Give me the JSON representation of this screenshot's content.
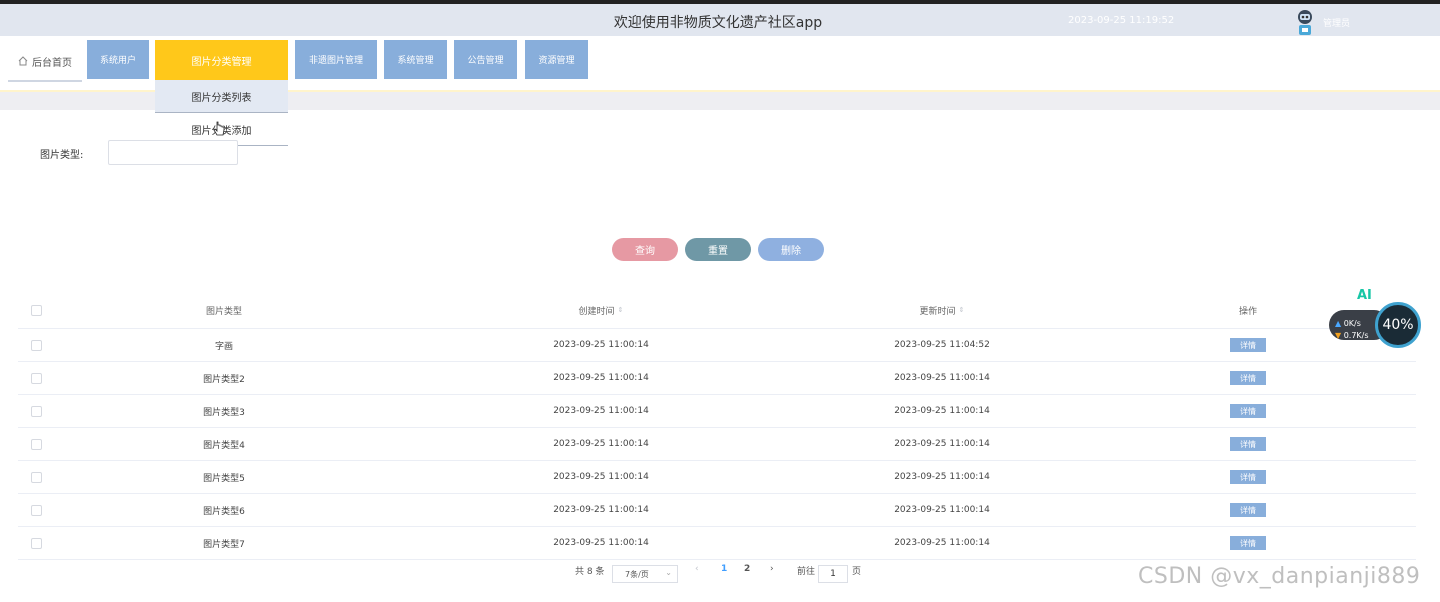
{
  "header": {
    "title": "欢迎使用非物质文化遗产社区app",
    "datetime": "2023-09-25 11:19:52",
    "user": "管理员"
  },
  "nav": {
    "home": "后台首页",
    "items": [
      "系统用户",
      "图片分类管理",
      "非遗图片管理",
      "系统管理",
      "公告管理",
      "资源管理"
    ],
    "active_index": 1,
    "dropdown": [
      "图片分类列表",
      "图片分类添加"
    ]
  },
  "filter": {
    "label": "图片类型:",
    "value": ""
  },
  "buttons": {
    "search": "查询",
    "reset": "重置",
    "delete": "删除"
  },
  "table": {
    "headers": {
      "type": "图片类型",
      "created": "创建时间",
      "updated": "更新时间",
      "op": "操作"
    },
    "sort_icon": "⇕",
    "rows": [
      {
        "type": "字画",
        "created": "2023-09-25 11:00:14",
        "updated": "2023-09-25 11:04:52",
        "op": "详情"
      },
      {
        "type": "图片类型2",
        "created": "2023-09-25 11:00:14",
        "updated": "2023-09-25 11:00:14",
        "op": "详情"
      },
      {
        "type": "图片类型3",
        "created": "2023-09-25 11:00:14",
        "updated": "2023-09-25 11:00:14",
        "op": "详情"
      },
      {
        "type": "图片类型4",
        "created": "2023-09-25 11:00:14",
        "updated": "2023-09-25 11:00:14",
        "op": "详情"
      },
      {
        "type": "图片类型5",
        "created": "2023-09-25 11:00:14",
        "updated": "2023-09-25 11:00:14",
        "op": "详情"
      },
      {
        "type": "图片类型6",
        "created": "2023-09-25 11:00:14",
        "updated": "2023-09-25 11:00:14",
        "op": "详情"
      },
      {
        "type": "图片类型7",
        "created": "2023-09-25 11:00:14",
        "updated": "2023-09-25 11:00:14",
        "op": "详情"
      }
    ]
  },
  "pagination": {
    "total": "共 8 条",
    "page_size": "7条/页",
    "prev": "‹",
    "pages": [
      "1",
      "2"
    ],
    "next": "›",
    "goto_label": "前往",
    "goto_value": "1",
    "goto_suffix": "页"
  },
  "net_widget": {
    "percent": "40%",
    "up": "0K/s",
    "down": "0.7K/s",
    "ai_label": "AI"
  },
  "watermark": "CSDN @vx_danpianji889",
  "colors": {
    "nav_blue": "#88aedb",
    "active_yellow": "#ffc81a",
    "search_pink": "#e699a3",
    "reset_teal": "#6f98a6"
  }
}
